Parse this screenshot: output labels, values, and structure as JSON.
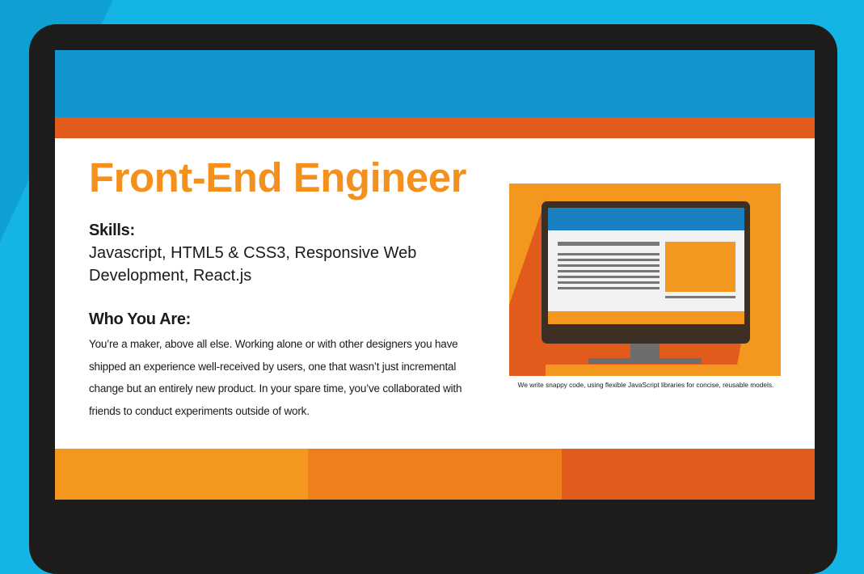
{
  "heading": {
    "title": "Front-End Engineer"
  },
  "skills": {
    "label": "Skills:",
    "text": "Javascript, HTML5 & CSS3, Responsive Web Development, React.js"
  },
  "who": {
    "label": "Who You Are:",
    "text": "You’re a maker, above all else. Working alone or with other designers you have shipped an experience well-received by users, one that wasn’t just incremental change but an entirely new product. In your spare time, you’ve collaborated with friends to conduct experiments outside of work."
  },
  "illustration": {
    "icon": "computer-monitor-icon",
    "caption": "We write snappy code, using flexible JavaScript libraries for concise, reusable models."
  },
  "colors": {
    "background": "#14b4e4",
    "bezel": "#1e1c1b",
    "header_blue": "#1396cf",
    "accent_orange": "#e05b1c",
    "title_orange": "#f4901e",
    "footer": [
      "#f4971e",
      "#ef7f1a",
      "#e05b1c"
    ]
  }
}
